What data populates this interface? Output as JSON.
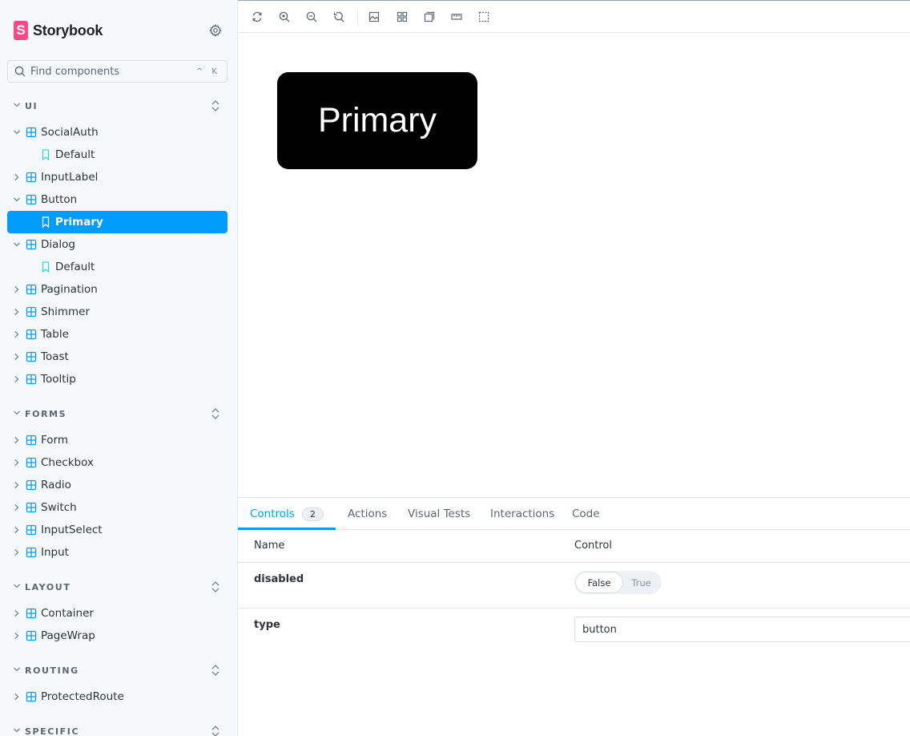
{
  "brand": {
    "mark": "S",
    "name": "Storybook"
  },
  "search": {
    "placeholder": "Find components",
    "shortcut": "^ K"
  },
  "sidebar": {
    "groups": [
      {
        "label": "UI"
      },
      {
        "label": "FORMS"
      },
      {
        "label": "LAYOUT"
      },
      {
        "label": "ROUTING"
      },
      {
        "label": "SPECIFIC"
      }
    ],
    "ui": [
      {
        "label": "SocialAuth",
        "expanded": true
      },
      {
        "label": "Default"
      },
      {
        "label": "InputLabel"
      },
      {
        "label": "Button",
        "expanded": true
      },
      {
        "label": "Primary",
        "active": true
      },
      {
        "label": "Dialog",
        "expanded": true
      },
      {
        "label": "Default"
      },
      {
        "label": "Pagination"
      },
      {
        "label": "Shimmer"
      },
      {
        "label": "Table"
      },
      {
        "label": "Toast"
      },
      {
        "label": "Tooltip"
      }
    ],
    "forms": [
      {
        "label": "Form"
      },
      {
        "label": "Checkbox"
      },
      {
        "label": "Radio"
      },
      {
        "label": "Switch"
      },
      {
        "label": "InputSelect"
      },
      {
        "label": "Input"
      }
    ],
    "layout": [
      {
        "label": "Container"
      },
      {
        "label": "PageWrap"
      }
    ],
    "routing": [
      {
        "label": "ProtectedRoute"
      }
    ]
  },
  "toolbar": {
    "buttons": [
      "reload-icon",
      "zoom-in-icon",
      "zoom-out-icon",
      "zoom-reset-icon",
      "background-icon",
      "grid-icon",
      "outline-icon",
      "measure-icon",
      "viewport-icon"
    ]
  },
  "preview": {
    "button_label": "Primary"
  },
  "addons": {
    "tabs": [
      {
        "label": "Controls",
        "badge": "2"
      },
      {
        "label": "Actions"
      },
      {
        "label": "Visual Tests"
      },
      {
        "label": "Interactions"
      },
      {
        "label": "Code"
      }
    ],
    "columns": {
      "name": "Name",
      "control": "Control"
    },
    "rows": [
      {
        "name": "disabled",
        "options": [
          "False",
          "True"
        ],
        "selected": "False"
      },
      {
        "name": "type",
        "value": "button"
      }
    ]
  },
  "colors": {
    "accent": "#029cfd",
    "brand": "#ff4785",
    "preview_bg": "#000000"
  }
}
